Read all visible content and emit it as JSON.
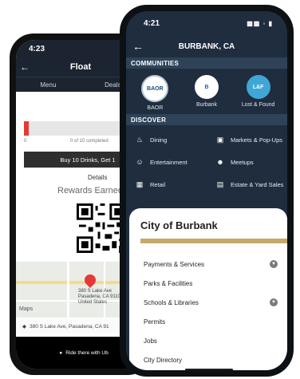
{
  "back_phone": {
    "time": "4:23",
    "header_title": "Float",
    "tabs": [
      "Menu",
      "Deals"
    ],
    "progress": {
      "start_label": "0",
      "middle_label": "0 of 10 completed",
      "fraction": 0.04
    },
    "buy_button": "Buy 10 Drinks, Get 1",
    "details_label": "Details",
    "rewards_title": "Rewards Earned",
    "map": {
      "pin_address_line1": "380 S Lake Ave",
      "pin_address_line2": "Pasadena, CA 91101",
      "pin_address_line3": "United States",
      "logo": "Maps"
    },
    "address_row": "380 S Lake Ave, Pasadena, CA 91",
    "ride_button": "Ride there with Ub"
  },
  "front_phone": {
    "time": "4:21",
    "header_title": "BURBANK, CA",
    "communities_title": "COMMUNITIES",
    "communities": [
      {
        "label": "BAOR",
        "badge": "BAOR"
      },
      {
        "label": "Burbank",
        "badge": "B"
      },
      {
        "label": "Lost & Found",
        "badge": "L&F"
      }
    ],
    "discover_title": "DISCOVER",
    "discover": [
      {
        "label": "Dining",
        "icon": "fork-knife-icon"
      },
      {
        "label": "Markets & Pop-Ups",
        "icon": "cart-icon"
      },
      {
        "label": "Entertainment",
        "icon": "theater-icon"
      },
      {
        "label": "Meetups",
        "icon": "people-icon"
      },
      {
        "label": "Retail",
        "icon": "store-icon"
      },
      {
        "label": "Estate & Yard Sales",
        "icon": "tag-icon"
      }
    ],
    "city_card": {
      "title": "City of Burbank",
      "accent_color": "#c9a86a",
      "items": [
        {
          "label": "Payments & Services",
          "expandable": true
        },
        {
          "label": "Parks & Facilities",
          "expandable": false
        },
        {
          "label": "Schools & Libraries",
          "expandable": true
        },
        {
          "label": "Permits",
          "expandable": false
        },
        {
          "label": "Jobs",
          "expandable": false
        },
        {
          "label": "City Directory",
          "expandable": false
        }
      ]
    }
  }
}
